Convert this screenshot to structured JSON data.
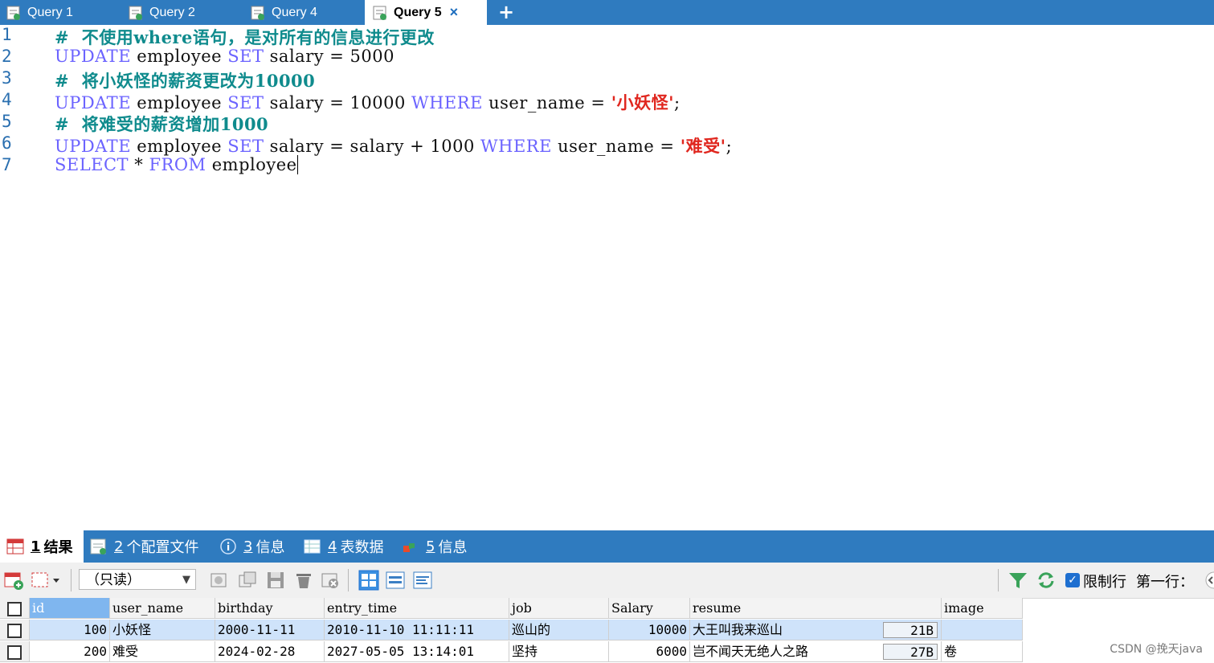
{
  "query_tabs": [
    {
      "label": "Query 1",
      "active": false
    },
    {
      "label": "Query 2",
      "active": false
    },
    {
      "label": "Query 4",
      "active": false
    },
    {
      "label": "Query 5",
      "active": true
    }
  ],
  "tab_close": "×",
  "tab_add": "+",
  "editor": {
    "line_numbers": [
      "1",
      "2",
      "3",
      "4",
      "5",
      "6",
      "7"
    ],
    "lines": [
      [
        {
          "t": "cm",
          "v": "#  不使用where语句，是对所有的信息进行更改"
        }
      ],
      [
        {
          "t": "kw",
          "v": "UPDATE"
        },
        {
          "t": "tx",
          "v": " employee "
        },
        {
          "t": "kw",
          "v": "SET"
        },
        {
          "t": "tx",
          "v": " salary = 5000"
        }
      ],
      [
        {
          "t": "cm",
          "v": "#  将小妖怪的薪资更改为10000"
        }
      ],
      [
        {
          "t": "kw",
          "v": "UPDATE"
        },
        {
          "t": "tx",
          "v": " employee "
        },
        {
          "t": "kw",
          "v": "SET"
        },
        {
          "t": "tx",
          "v": " salary = 10000 "
        },
        {
          "t": "kw",
          "v": "WHERE"
        },
        {
          "t": "tx",
          "v": " user_name = "
        },
        {
          "t": "str",
          "v": "'小妖怪'"
        },
        {
          "t": "tx",
          "v": ";"
        }
      ],
      [
        {
          "t": "cm",
          "v": "#  将难受的薪资增加1000"
        }
      ],
      [
        {
          "t": "kw",
          "v": "UPDATE"
        },
        {
          "t": "tx",
          "v": " employee "
        },
        {
          "t": "kw",
          "v": "SET"
        },
        {
          "t": "tx",
          "v": " salary = salary + 1000 "
        },
        {
          "t": "kw",
          "v": "WHERE"
        },
        {
          "t": "tx",
          "v": " user_name = "
        },
        {
          "t": "str",
          "v": "'难受'"
        },
        {
          "t": "tx",
          "v": ";"
        }
      ],
      [
        {
          "t": "kw",
          "v": "SELECT"
        },
        {
          "t": "tx",
          "v": " * "
        },
        {
          "t": "kw",
          "v": "FROM"
        },
        {
          "t": "tx",
          "v": " employee"
        }
      ]
    ]
  },
  "result_tabs": [
    {
      "num": "1",
      "label": "结果",
      "active": true
    },
    {
      "num": "2",
      "label": "个配置文件",
      "active": false
    },
    {
      "num": "3",
      "label": "信息",
      "active": false
    },
    {
      "num": "4",
      "label": "表数据",
      "active": false
    },
    {
      "num": "5",
      "label": "信息",
      "active": false
    }
  ],
  "toolbar": {
    "mode_select": "（只读）",
    "limit_label": "限制行",
    "first_row_label": "第一行："
  },
  "grid": {
    "columns": [
      "id",
      "user_name",
      "birthday",
      "entry_time",
      "job",
      "Salary",
      "resume",
      "image"
    ],
    "rows": [
      {
        "id": "100",
        "user_name": "小妖怪",
        "birthday": "2000-11-11",
        "entry_time": "2010-11-10 11:11:11",
        "job": "巡山的",
        "salary": "10000",
        "resume": "大王叫我来巡山",
        "resume_size": "21B",
        "image": ""
      },
      {
        "id": "200",
        "user_name": "难受",
        "birthday": "2024-02-28",
        "entry_time": "2027-05-05 13:14:01",
        "job": "坚持",
        "salary": "6000",
        "resume": "岂不闻天无绝人之路",
        "resume_size": "27B",
        "image": "卷"
      }
    ]
  },
  "watermark": "CSDN @挽天java",
  "colors": {
    "tabbar": "#2f7bbf",
    "keyword": "#6b63ff",
    "comment": "#0f8b8d",
    "string": "#e0271f",
    "selected_row": "#cfe3fa"
  }
}
